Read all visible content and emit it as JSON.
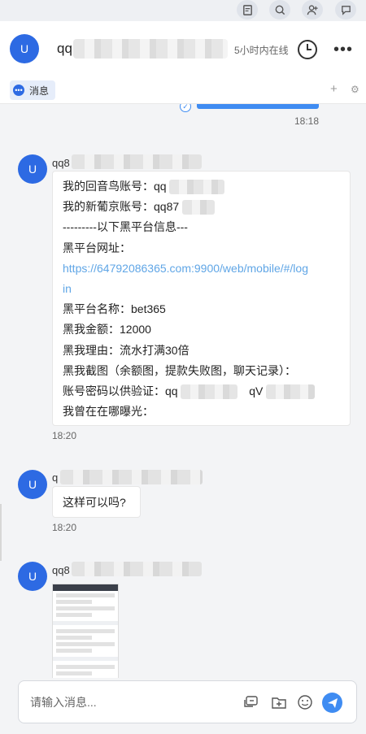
{
  "header": {
    "avatar_letter": "U",
    "name_prefix": "qq",
    "status": "5小时内在线",
    "more": "•••"
  },
  "tabs": {
    "messages_label": "消息",
    "messages_icon": "•••"
  },
  "subbar": {
    "add": "+",
    "settings": "⚙"
  },
  "chat": {
    "check_glyph": "✓",
    "timestamp_1": "18:18",
    "messages": [
      {
        "avatar": "U",
        "sender_prefix": "qq8",
        "lines": [
          "我的回音鸟账号：qq",
          "我的新葡京账号：qq87",
          "---------以下黑平台信息---",
          "黑平台网址：",
          "https://64792086365.com:9900/web/mobile/#/log",
          "in",
          "黑平台名称：bet365",
          "黑我金额：12000",
          "黑我理由：流水打满30倍",
          "黑我截图（余额图，提款失败图，聊天记录）：",
          "账号密码以供验证：qq",
          "qV",
          "我曾在在哪曝光："
        ],
        "time": "18:20"
      },
      {
        "avatar": "U",
        "sender_prefix": "q",
        "text": "这样可以吗?",
        "time": "18:20"
      },
      {
        "avatar": "U",
        "sender_prefix": "qq8",
        "image": "screenshot-thumbnail"
      }
    ]
  },
  "composer": {
    "placeholder": "请输入消息..."
  },
  "colors": {
    "accent": "#2d6ae3",
    "link": "#60a6e6",
    "send": "#3f8cf2"
  }
}
